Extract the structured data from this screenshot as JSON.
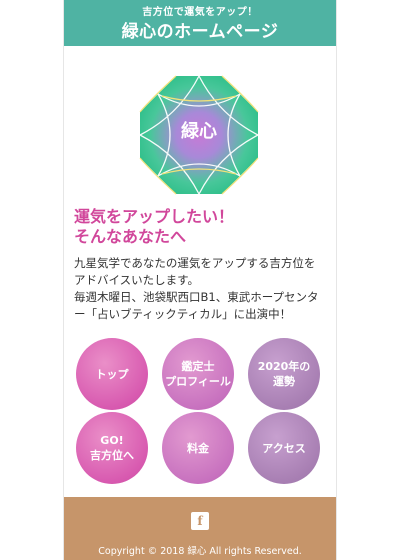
{
  "header": {
    "subtitle": "吉方位で運気をアップ！",
    "title": "緑心のホームページ",
    "bg_color": "#4fb3a3"
  },
  "logo": {
    "text": "緑心"
  },
  "main": {
    "headline_line1": "運気をアップしたい！",
    "headline_line2": "そんなあなたへ",
    "body_lines": [
      "九星気学であなたの運気をアップする吉方位を",
      "アドバイスいたします。",
      "毎週木曜日、池袋駅西口B1、東武ホープセンタ",
      "ー「占いブティックティカル」に出演中！"
    ]
  },
  "nav": {
    "items": [
      {
        "line1": "トップ",
        "line2": ""
      },
      {
        "line1": "鑑定士",
        "line2": "プロフィール"
      },
      {
        "line1": "2020年の",
        "line2": "運勢"
      },
      {
        "line1": "GO!",
        "line2": "吉方位へ"
      },
      {
        "line1": "料金",
        "line2": ""
      },
      {
        "line1": "アクセス",
        "line2": ""
      }
    ]
  },
  "footer": {
    "social_icon": "facebook-icon",
    "social_glyph": "f",
    "copyright": "Copyright © 2018 緑心 All rights Reserved.",
    "bg_color": "#c6956a"
  },
  "colors": {
    "accent_pink": "#d1479b",
    "accent_purple": "#a274a8"
  }
}
